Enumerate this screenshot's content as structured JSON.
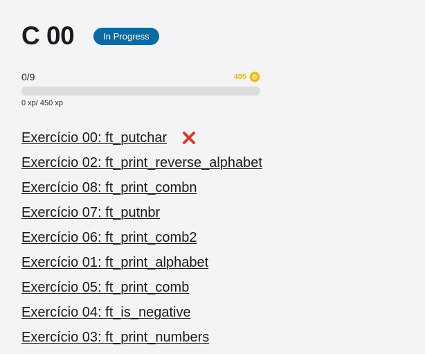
{
  "project": {
    "title": "C 00",
    "status": "In Progress"
  },
  "progress": {
    "count": "0/9",
    "completed": 0,
    "total": 9,
    "coins": "405",
    "xp": "0 xp/ 450 xp"
  },
  "exercises": [
    {
      "label": "Exercício 00: ft_putchar",
      "failed": true
    },
    {
      "label": "Exercício 02: ft_print_reverse_alphabet"
    },
    {
      "label": "Exercício 08: ft_print_combn"
    },
    {
      "label": "Exercício 07: ft_putnbr"
    },
    {
      "label": "Exercício 06: ft_print_comb2"
    },
    {
      "label": "Exercício 01: ft_print_alphabet"
    },
    {
      "label": "Exercício 05: ft_print_comb"
    },
    {
      "label": "Exercício 04: ft_is_negative"
    },
    {
      "label": "Exercício 03: ft_print_numbers"
    }
  ],
  "icons": {
    "coin": "coin-icon",
    "fail": "red-x-icon"
  },
  "colors": {
    "accent": "#0a6aa1",
    "coin": "#e8b72a",
    "fail": "#e0342f",
    "track": "#dcdcdc"
  }
}
